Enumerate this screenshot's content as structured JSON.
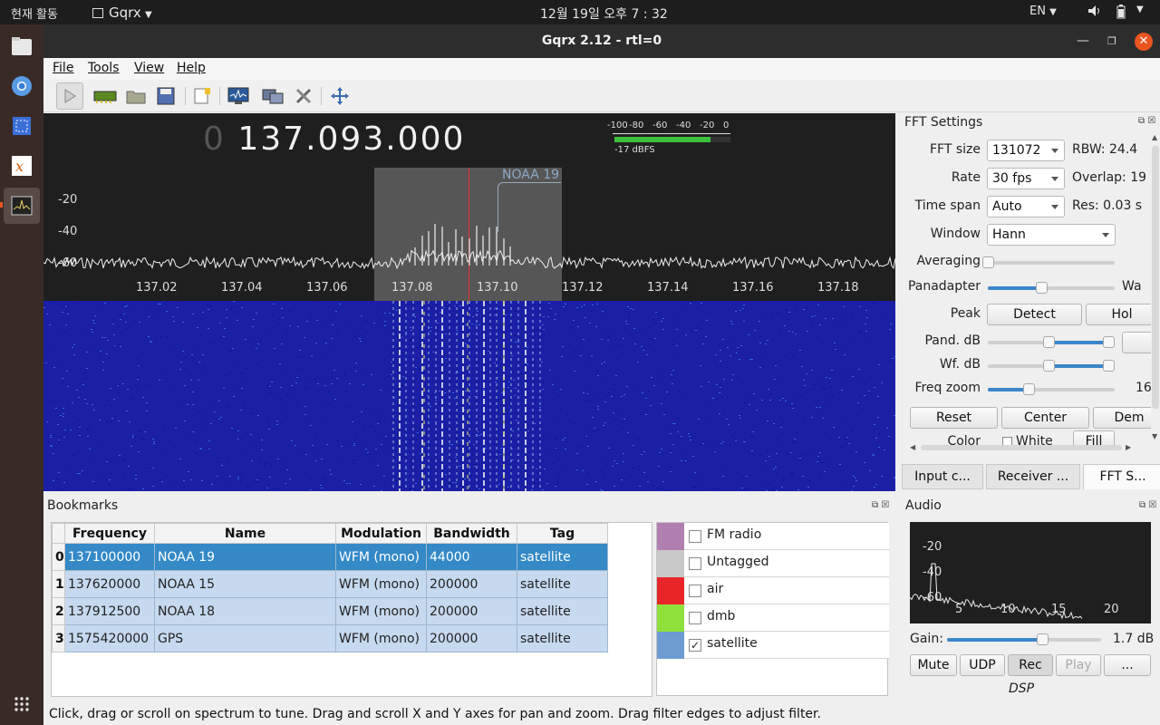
{
  "topbar": {
    "activities": "현재 활동",
    "app_name": "Gqrx",
    "clock": "12월 19일  오후 7 : 32",
    "lang": "EN"
  },
  "window": {
    "title": "Gqrx 2.12 - rtl=0"
  },
  "menu": {
    "file": "File",
    "tools": "Tools",
    "view": "View",
    "help": "Help"
  },
  "frequency": {
    "prefix": "0",
    "value": "137.093.000"
  },
  "meter": {
    "scale": [
      "-100",
      "-80",
      "-60",
      "-40",
      "-20",
      "0"
    ],
    "reading": "-17 dBFS",
    "level_fraction": 0.83
  },
  "spectrum": {
    "y_labels": [
      "-20",
      "-40",
      "-60"
    ],
    "x_labels": [
      "137.02",
      "137.04",
      "137.06",
      "137.08",
      "137.10",
      "137.12",
      "137.14",
      "137.16",
      "137.18"
    ],
    "bookmark_label": "NOAA 19"
  },
  "fft_settings": {
    "title": "FFT Settings",
    "fft_size_label": "FFT size",
    "fft_size_value": "131072",
    "rbw": "RBW: 24.4",
    "rate_label": "Rate",
    "rate_value": "30 fps",
    "overlap": "Overlap: 19",
    "time_span_label": "Time span",
    "time_span_value": "Auto",
    "res": "Res: 0.03 s",
    "window_label": "Window",
    "window_value": "Hann",
    "averaging_label": "Averaging",
    "panadapter_label": "Panadapter",
    "panadapter_right": "Wa",
    "peak_label": "Peak",
    "detect_btn": "Detect",
    "hold_btn": "Hol",
    "pand_db_label": "Pand. dB",
    "wf_db_label": "Wf. dB",
    "freq_zoom_label": "Freq zoom",
    "freq_zoom_value": "16",
    "reset_btn": "Reset",
    "center_btn": "Center",
    "demod_btn": "Dem",
    "color_label": "Color",
    "white_label": "White",
    "fill_btn": "Fill",
    "averaging_value": 0.0,
    "panadapter_value": 0.42,
    "pand_db_low": 0.48,
    "pand_db_high": 0.95,
    "wf_db_low": 0.48,
    "wf_db_high": 0.95,
    "freq_zoom_fraction": 0.32
  },
  "tabs": [
    "Input c...",
    "Receiver ...",
    "FFT S..."
  ],
  "bookmarks": {
    "title": "Bookmarks",
    "columns": [
      "Frequency",
      "Name",
      "Modulation",
      "Bandwidth",
      "Tag"
    ],
    "rows": [
      {
        "idx": "0",
        "frequency": "137100000",
        "name": "NOAA 19",
        "modulation": "WFM (mono)",
        "bandwidth": "44000",
        "tag": "satellite"
      },
      {
        "idx": "1",
        "frequency": "137620000",
        "name": "NOAA 15",
        "modulation": "WFM (mono)",
        "bandwidth": "200000",
        "tag": "satellite"
      },
      {
        "idx": "2",
        "frequency": "137912500",
        "name": "NOAA 18",
        "modulation": "WFM (mono)",
        "bandwidth": "200000",
        "tag": "satellite"
      },
      {
        "idx": "3",
        "frequency": "1575420000",
        "name": "GPS",
        "modulation": "WFM (mono)",
        "bandwidth": "200000",
        "tag": "satellite"
      }
    ],
    "tags": [
      {
        "name": "FM radio",
        "color": "#b07fb0",
        "checked": ""
      },
      {
        "name": "Untagged",
        "color": "#c8c8c8",
        "checked": ""
      },
      {
        "name": "air",
        "color": "#e8262a",
        "checked": ""
      },
      {
        "name": "dmb",
        "color": "#8ee03a",
        "checked": ""
      },
      {
        "name": "satellite",
        "color": "#6d9bd2",
        "checked": "✓"
      }
    ]
  },
  "audio": {
    "title": "Audio",
    "y_labels": [
      "-20",
      "-40",
      "-60"
    ],
    "x_labels": [
      "5",
      "10",
      "15",
      "20"
    ],
    "gain_label": "Gain:",
    "gain_value": "1.7 dB",
    "gain_fraction": 0.62,
    "mute_btn": "Mute",
    "udp_btn": "UDP",
    "rec_btn": "Rec",
    "play_btn": "Play",
    "more_btn": "...",
    "dsp_label": "DSP"
  },
  "status": {
    "text": "Click, drag or scroll on spectrum to tune. Drag and scroll X and Y axes for pan and zoom. Drag filter edges to adjust filter."
  }
}
